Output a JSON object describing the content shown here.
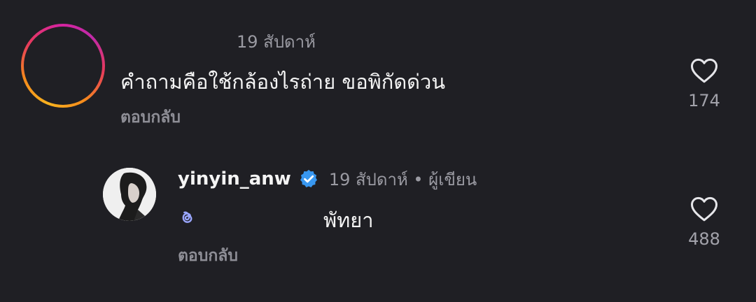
{
  "comment": {
    "time": "19 สัปดาห์",
    "text": "คำถามคือใช้กล้องไรถ่าย ขอพิกัดด่วน",
    "reply_label": "ตอบกลับ",
    "like_icon": "heart-outline-icon",
    "likes": "174"
  },
  "reply": {
    "username": "yinyin_anw",
    "verified_icon": "verified-badge-icon",
    "meta": "19 สัปดาห์ • ผู้เขียน",
    "threads_icon": "threads-icon",
    "text": "พัทยา",
    "reply_label": "ตอบกลับ",
    "like_icon": "heart-outline-icon",
    "likes": "488"
  },
  "colors": {
    "background": "#1f1f24",
    "verified": "#3897f0",
    "threads_icon": "#9aa6ff"
  }
}
